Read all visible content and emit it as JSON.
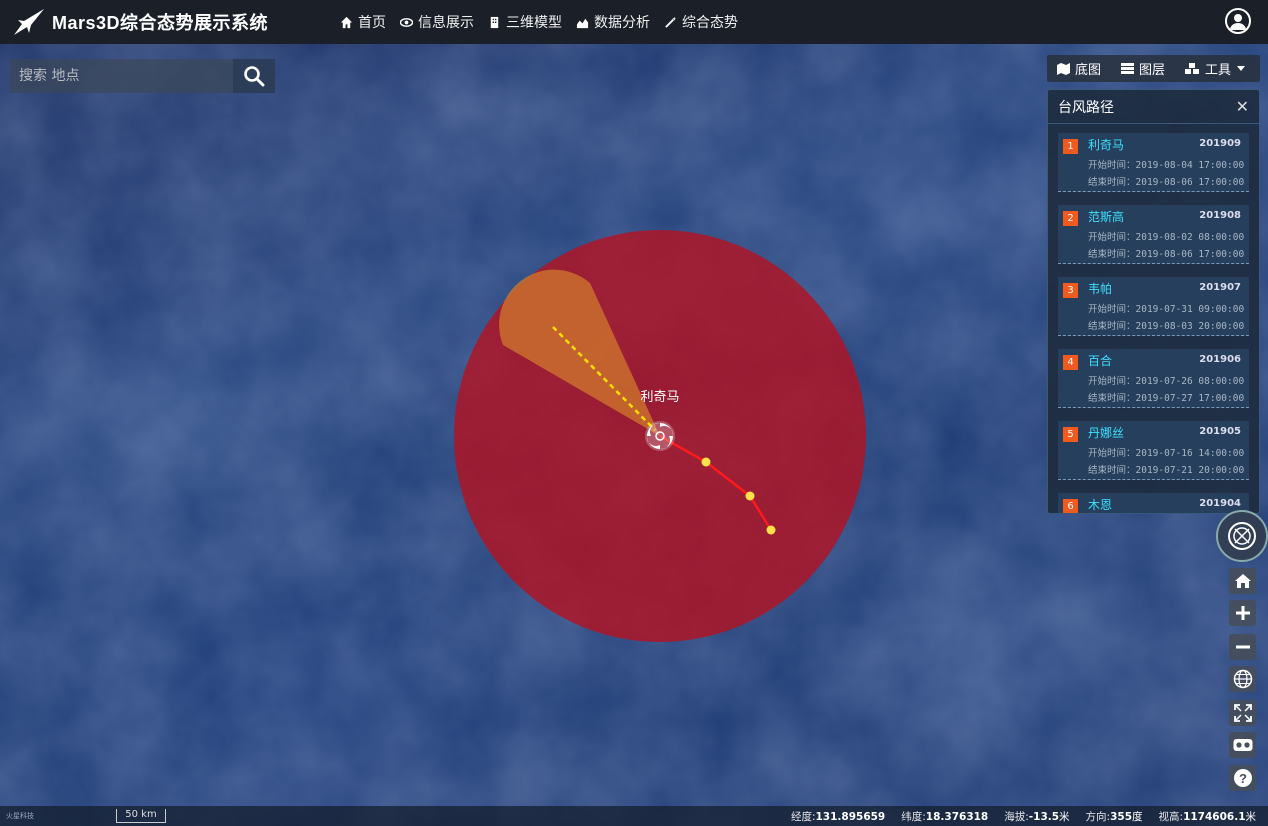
{
  "app": {
    "title": "Mars3D综合态势展示系统"
  },
  "nav": [
    {
      "label": "首页",
      "icon": "home-icon"
    },
    {
      "label": "信息展示",
      "icon": "eye-icon"
    },
    {
      "label": "三维模型",
      "icon": "building-icon"
    },
    {
      "label": "数据分析",
      "icon": "area-chart-icon"
    },
    {
      "label": "综合态势",
      "icon": "magic-wand-icon"
    }
  ],
  "search": {
    "placeholder": "搜索 地点"
  },
  "toolbar": {
    "basemap": "底图",
    "layers": "图层",
    "tools": "工具"
  },
  "panel": {
    "title": "台风路径",
    "start_prefix": "开始时间：",
    "end_prefix": "结束时间：",
    "items": [
      {
        "num": "1",
        "name": "利奇马",
        "code": "201909",
        "start": "2019-08-04 17:00:00",
        "end": "2019-08-06 17:00:00"
      },
      {
        "num": "2",
        "name": "范斯高",
        "code": "201908",
        "start": "2019-08-02 08:00:00",
        "end": "2019-08-06 17:00:00"
      },
      {
        "num": "3",
        "name": "韦帕",
        "code": "201907",
        "start": "2019-07-31 09:00:00",
        "end": "2019-08-03 20:00:00"
      },
      {
        "num": "4",
        "name": "百合",
        "code": "201906",
        "start": "2019-07-26 08:00:00",
        "end": "2019-07-27 17:00:00"
      },
      {
        "num": "5",
        "name": "丹娜丝",
        "code": "201905",
        "start": "2019-07-16 14:00:00",
        "end": "2019-07-21 20:00:00"
      },
      {
        "num": "6",
        "name": "木恩",
        "code": "201904",
        "start": "",
        "end": ""
      }
    ]
  },
  "map": {
    "typhoon_label": "利奇马",
    "colors": {
      "wind_circle": "#b8101e",
      "forecast_cone": "#d07a2c",
      "track": "#ff1a1a",
      "forecast_line": "#ffe000"
    }
  },
  "status": {
    "credits": "火星科技",
    "scale": "50 km",
    "lon_label": "经度:",
    "lon": "131.895659",
    "lat_label": "纬度:",
    "lat": "18.376318",
    "alt_label": "海拔:",
    "alt": "-13.5",
    "alt_unit": "米",
    "heading_label": "方向:",
    "heading": "355",
    "heading_unit": "度",
    "view_label": "视高:",
    "view": "1174606.1",
    "view_unit": "米"
  }
}
